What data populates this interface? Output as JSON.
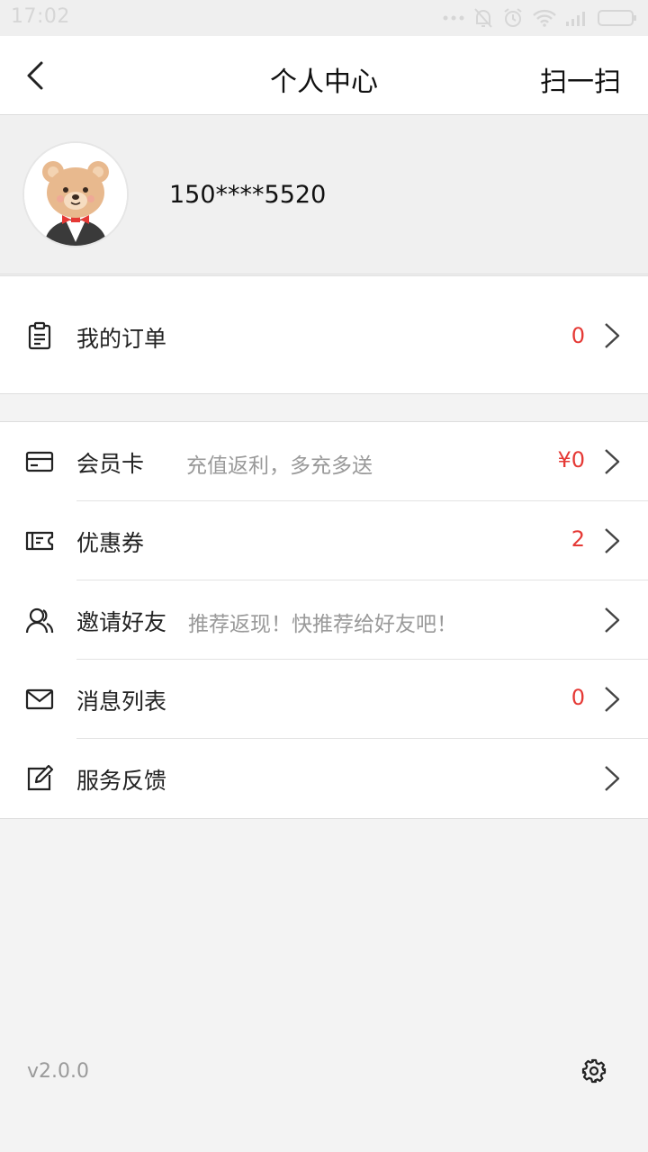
{
  "status": {
    "time": "17:02",
    "icons": [
      "more-dots-icon",
      "bell-off-icon",
      "alarm-icon",
      "wifi-icon",
      "signal-icon",
      "battery-icon"
    ]
  },
  "header": {
    "back_icon": "back-arrow-icon",
    "title": "个人中心",
    "scan_label": "扫一扫"
  },
  "profile": {
    "avatar": "bear-avatar",
    "phone": "150****5520"
  },
  "orders": {
    "icon": "clipboard-icon",
    "label": "我的订单",
    "count": "0"
  },
  "menu": [
    {
      "icon": "card-icon",
      "label": "会员卡",
      "sub": "充值返利，多充多送",
      "value": "¥0"
    },
    {
      "icon": "ticket-icon",
      "label": "优惠券",
      "sub": "",
      "value": "2"
    },
    {
      "icon": "users-icon",
      "label": "邀请好友",
      "sub": "推荐返现！快推荐给好友吧！",
      "value": ""
    },
    {
      "icon": "mail-icon",
      "label": "消息列表",
      "sub": "",
      "value": "0"
    },
    {
      "icon": "edit-icon",
      "label": "服务反馈",
      "sub": "",
      "value": ""
    }
  ],
  "footer": {
    "version": "v2.0.0",
    "settings_icon": "gear-icon"
  },
  "colors": {
    "accent_red": "#e53935",
    "background": "#f3f3f3",
    "text_secondary": "#999999"
  }
}
